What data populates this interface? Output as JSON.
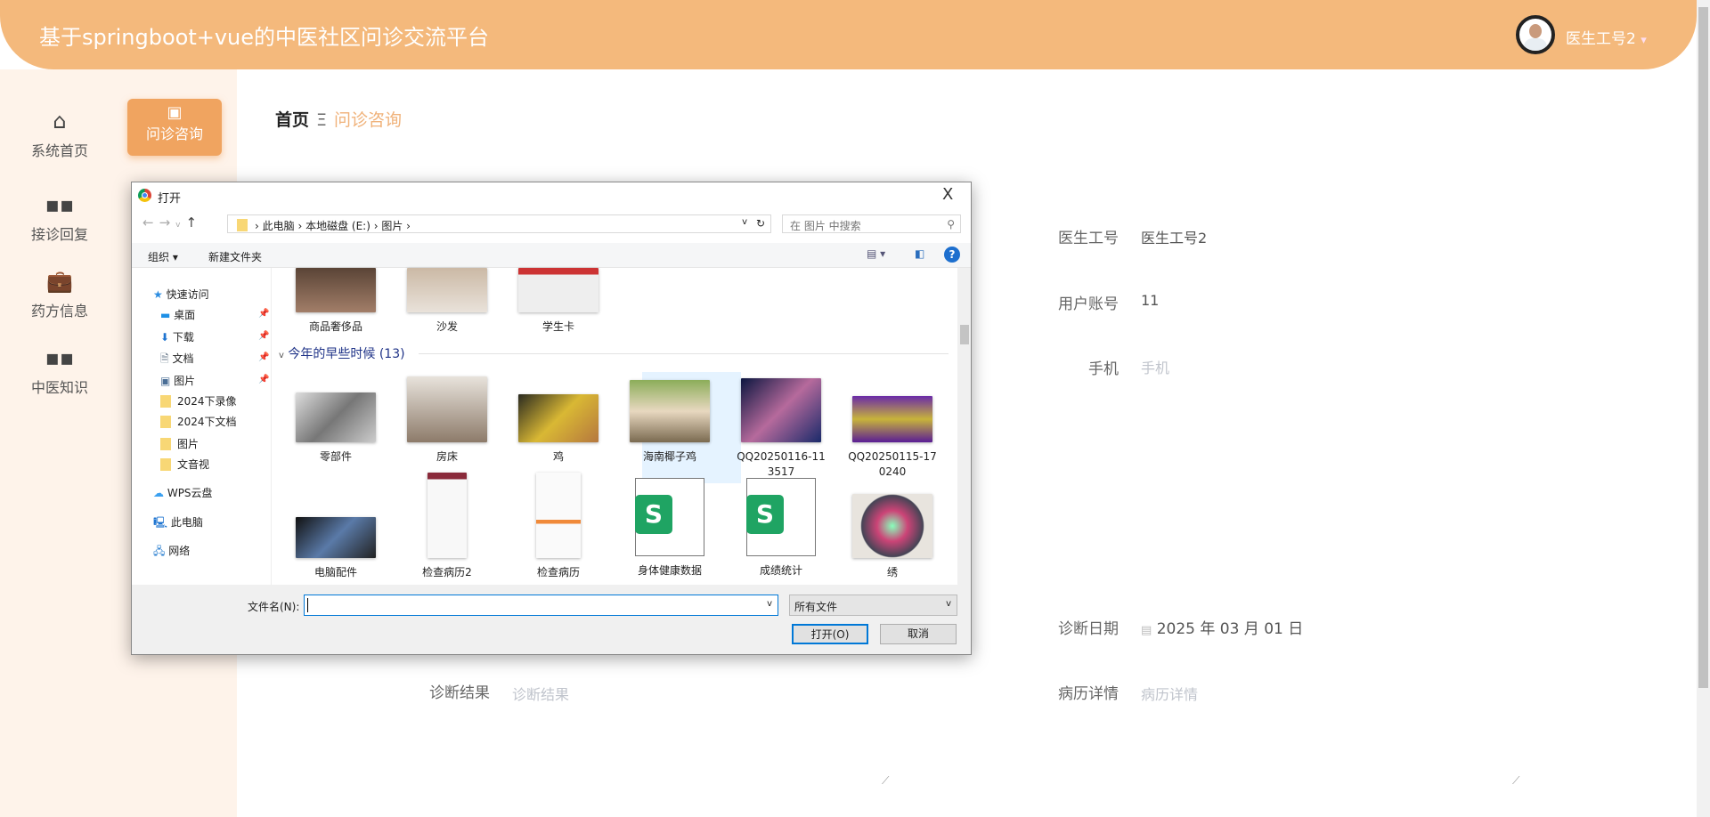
{
  "header": {
    "title": "基于springboot+vue的中医社区问诊交流平台",
    "user": "医生工号2",
    "caret": "▾"
  },
  "sidebar": {
    "items": [
      {
        "label": "系统首页",
        "icon": "home-icon"
      },
      {
        "label": "接诊回复",
        "icon": "grid-icon"
      },
      {
        "label": "药方信息",
        "icon": "briefcase-icon"
      },
      {
        "label": "中医知识",
        "icon": "grid-icon"
      }
    ],
    "active": {
      "label": "问诊咨询",
      "icon": "wallet-icon"
    }
  },
  "breadcrumb": {
    "home": "首页",
    "sep": "Ξ",
    "current": "问诊咨询"
  },
  "form": {
    "doctor_id": {
      "label": "医生工号",
      "value": "医生工号2"
    },
    "account": {
      "label": "用户账号",
      "value": "11"
    },
    "phone": {
      "label": "手机",
      "placeholder": "手机"
    },
    "date": {
      "label": "诊断日期",
      "value": "2025 年 03 月 01 日"
    },
    "detail": {
      "label": "病历详情",
      "placeholder": "病历详情"
    },
    "result": {
      "label": "诊断结果",
      "placeholder": "诊断结果"
    }
  },
  "dialog": {
    "title": "打开",
    "close": "X",
    "path": [
      "此电脑",
      "本地磁盘 (E:)",
      "图片"
    ],
    "search_placeholder": "在 图片 中搜索",
    "toolbar": {
      "organize": "组织 ▾",
      "new_folder": "新建文件夹"
    },
    "nav": [
      "快速访问",
      "桌面",
      "下载",
      "文档",
      "图片",
      "2024下录像",
      "2024下文档",
      "图片",
      "文音视",
      "WPS云盘",
      "此电脑",
      "网络"
    ],
    "recent_files": [
      "商品奢侈品",
      "沙发",
      "学生卡"
    ],
    "group": "今年的早些时候 (13)",
    "files_row1": [
      "零部件",
      "房床",
      "鸡",
      "海南椰子鸡",
      "QQ20250116-113517",
      "QQ20250115-170240"
    ],
    "files_row2": [
      "电脑配件",
      "检查病历2",
      "检查病历",
      "身体健康数据",
      "成绩统计",
      "绣"
    ],
    "filename_label": "文件名(N):",
    "filename_value": "",
    "filter": "所有文件",
    "open": "打开(O)",
    "cancel": "取消",
    "selected": "鸡"
  }
}
